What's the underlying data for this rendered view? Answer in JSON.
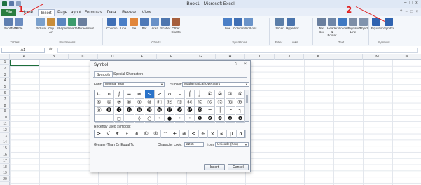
{
  "window": {
    "title": "Book1 - Microsoft Excel"
  },
  "tabs": [
    "File",
    "Home",
    "Insert",
    "Page Layout",
    "Formulas",
    "Data",
    "Review",
    "View"
  ],
  "ribbon": {
    "buttons": [
      {
        "label": "PivotTable",
        "color": "#5f7fb0"
      },
      {
        "label": "Table",
        "color": "#6b8cc0"
      },
      {
        "label": "Picture",
        "color": "#7aa0cc"
      },
      {
        "label": "Clip Art",
        "color": "#c98e3a"
      },
      {
        "label": "Shapes",
        "color": "#5a86c0"
      },
      {
        "label": "SmartArt",
        "color": "#3b9b6b"
      },
      {
        "label": "Screenshot",
        "color": "#6a7f9e"
      },
      {
        "label": "Column",
        "color": "#3f6fb5"
      },
      {
        "label": "Line",
        "color": "#4a7fc7"
      },
      {
        "label": "Pie",
        "color": "#e1863a"
      },
      {
        "label": "Bar",
        "color": "#4f79b7"
      },
      {
        "label": "Area",
        "color": "#6891c8"
      },
      {
        "label": "Scatter",
        "color": "#4e76ae"
      },
      {
        "label": "Other Charts",
        "color": "#a65f3d"
      },
      {
        "label": "Line",
        "color": "#4a7fc7"
      },
      {
        "label": "Column",
        "color": "#3f6fb5"
      },
      {
        "label": "Win/Loss",
        "color": "#6a93c9"
      },
      {
        "label": "Slicer",
        "color": "#5b7ea8"
      },
      {
        "label": "Hyperlink",
        "color": "#4a74ad"
      },
      {
        "label": "Text Box",
        "color": "#6a7f9e"
      },
      {
        "label": "Header & Footer",
        "color": "#6e86a8"
      },
      {
        "label": "WordArt",
        "color": "#3f79c2"
      },
      {
        "label": "Signature Line",
        "color": "#7d8ea6"
      },
      {
        "label": "Object",
        "color": "#8093ad"
      },
      {
        "label": "Equation",
        "color": "#2f63b0"
      },
      {
        "label": "Symbol",
        "color": "#2f63b0"
      }
    ],
    "groups": [
      "Tables",
      "Illustrations",
      "Charts",
      "Sparklines",
      "Filter",
      "Links",
      "Text",
      "Symbols"
    ]
  },
  "formula_bar": {
    "name_box": "A1",
    "fx": "fx",
    "value": ""
  },
  "columns": [
    "A",
    "B",
    "C",
    "D",
    "E",
    "F",
    "G",
    "H",
    "I",
    "J",
    "K",
    "L",
    "M",
    "N"
  ],
  "rows": [
    "1",
    "2",
    "3",
    "4",
    "5",
    "6",
    "7",
    "8",
    "9",
    "10",
    "11",
    "12",
    "13",
    "14",
    "15",
    "16",
    "17",
    "18",
    "19",
    "20"
  ],
  "dialog": {
    "title": "Symbol",
    "help": "?",
    "close": "×",
    "tabs": [
      "Symbols",
      "Special Characters"
    ],
    "font_label": "Font:",
    "font_value": "(normal text)",
    "subset_label": "Subset:",
    "subset_value": "Mathematical Operators",
    "symbols": [
      [
        "∟",
        "∩",
        "∫",
        "=",
        "≠",
        "≤",
        "≥",
        "⌂",
        "–",
        "⌠",
        "⌡",
        "①",
        "②",
        "③",
        "④"
      ],
      [
        "⑤",
        "⑥",
        "⑦",
        "⑧",
        "⑨",
        "⑩",
        "⑪",
        "⑫",
        "⑬",
        "⑭",
        "⑮",
        "⑯",
        "⑰",
        "⑱",
        "⑲"
      ],
      [
        "⓪",
        "⓫",
        "⓬",
        "⓭",
        "⓮",
        "⓯",
        "⓰",
        "⓱",
        "⓲",
        "⓳",
        "⓴",
        "─",
        "│",
        "┌",
        "┐"
      ],
      [
        "└",
        "┘",
        "◻",
        "·",
        "◊",
        "○",
        "◦",
        "●",
        "◦",
        "◦",
        "❶",
        "❷",
        "❸",
        "❹",
        "❺"
      ]
    ],
    "selected_symbol_index": 5,
    "recent_label": "Recently used symbols:",
    "recent": [
      "≥",
      "√",
      "€",
      "£",
      "¥",
      "©",
      "®",
      "™",
      "±",
      "≠",
      "≤",
      "÷",
      "×",
      "∞",
      "µ",
      "α"
    ],
    "char_name": "Greater-Than Or Equal To",
    "code_label": "Character code:",
    "code_value": "2265",
    "from_label": "from:",
    "from_value": "Unicode (hex)",
    "insert_label": "Insert",
    "cancel_label": "Cancel"
  },
  "annotations": [
    "1",
    "2"
  ]
}
